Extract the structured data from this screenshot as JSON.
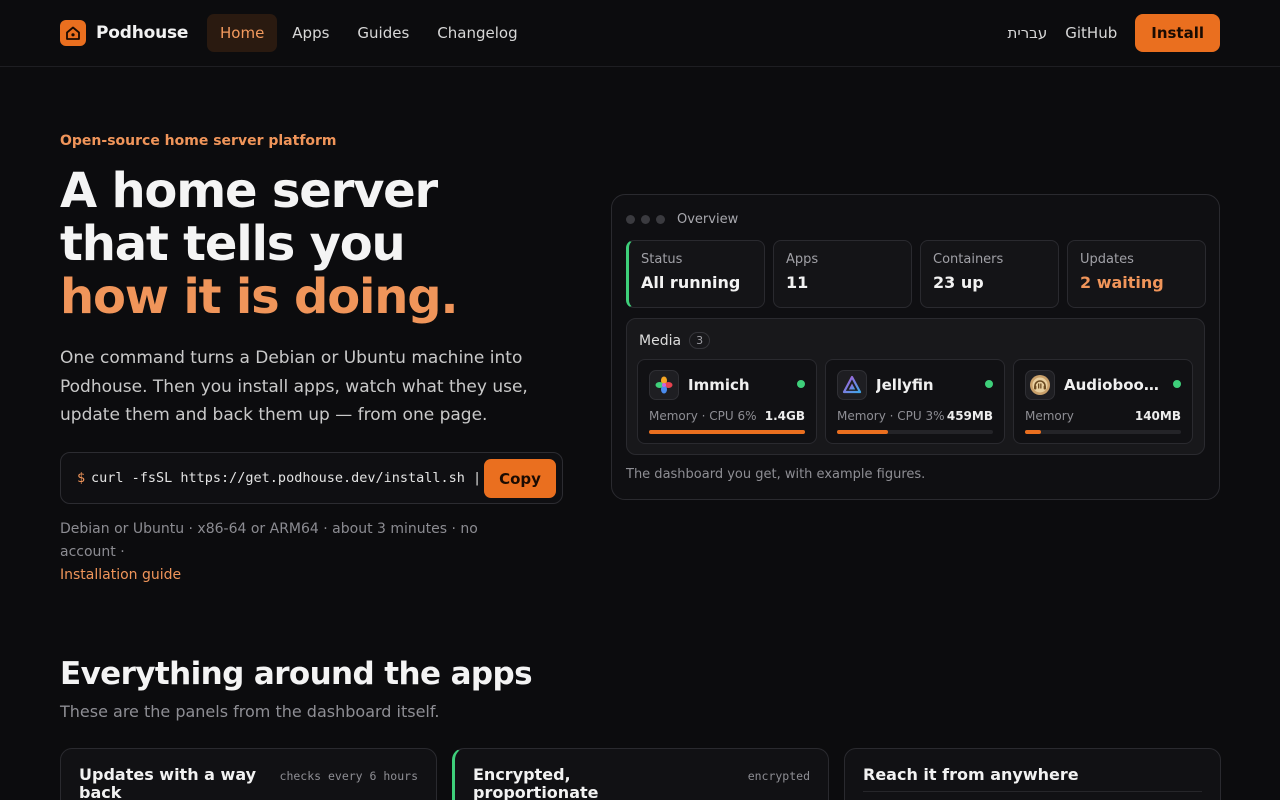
{
  "nav": {
    "brand": "Podhouse",
    "links": [
      "Home",
      "Apps",
      "Guides",
      "Changelog"
    ],
    "active": "Home",
    "language": "עברית",
    "github": "GitHub",
    "install": "Install"
  },
  "hero": {
    "eyebrow": "Open-source home server platform",
    "headline_1": "A home server",
    "headline_2": "that tells you",
    "headline_3": "how it is doing.",
    "lede": "One command turns a Debian or Ubuntu machine into Podhouse. Then you install apps, watch what they use, update them and back them up — from one page.",
    "prompt": "$",
    "command": "curl -fsSL https://get.podhouse.dev/install.sh |",
    "copy": "Copy",
    "meta": "Debian or Ubuntu · x86-64 or ARM64 · about 3 minutes · no account ·",
    "guide_link": "Installation guide"
  },
  "preview": {
    "title": "Overview",
    "stats": [
      {
        "label": "Status",
        "value": "All running"
      },
      {
        "label": "Apps",
        "value": "11"
      },
      {
        "label": "Containers",
        "value": "23 up"
      },
      {
        "label": "Updates",
        "value": "2 waiting"
      }
    ],
    "group": {
      "name": "Media",
      "count": "3"
    },
    "apps": [
      {
        "name": "Immich",
        "usage": "Memory · CPU 6%",
        "size": "1.4GB",
        "memory_fraction": 1.0
      },
      {
        "name": "Jellyfin",
        "usage": "Memory · CPU 3%",
        "size": "459MB",
        "memory_fraction": 0.33
      },
      {
        "name": "Audiobookshelf",
        "usage": "Memory",
        "size": "140MB",
        "memory_fraction": 0.1
      }
    ],
    "caption": "The dashboard you get, with example figures."
  },
  "features": {
    "title": "Everything around the apps",
    "subtitle": "These are the panels from the dashboard itself.",
    "cards": [
      {
        "title": "Updates with a way back",
        "tag": "checks every 6 hours"
      },
      {
        "title": "Encrypted, proportionate backups",
        "tag": "encrypted"
      },
      {
        "title": "Reach it from anywhere",
        "tag": ""
      }
    ]
  },
  "colors": {
    "accent": "#ea6f1f",
    "accent_text": "#f0955a",
    "ok": "#3ecf7a",
    "bg": "#0c0c0e"
  }
}
